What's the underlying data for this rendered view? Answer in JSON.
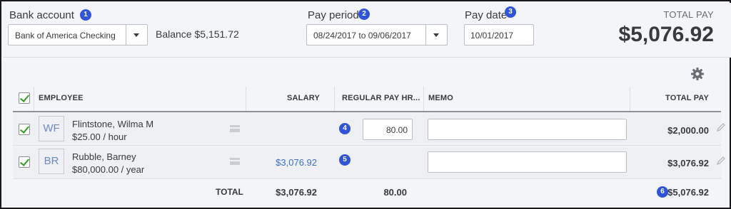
{
  "header": {
    "bank_account_label": "Bank account",
    "bank_account_value": "Bank of America Checking",
    "balance": "Balance $5,151.72",
    "pay_period_label": "Pay period",
    "pay_period_value": "08/24/2017 to 09/06/2017",
    "pay_date_label": "Pay date",
    "pay_date_value": "10/01/2017",
    "total_pay_label": "TOTAL PAY",
    "total_pay_value": "$5,076.92"
  },
  "badges": [
    "1",
    "2",
    "3",
    "4",
    "5",
    "6"
  ],
  "table": {
    "columns": [
      "EMPLOYEE",
      "SALARY",
      "REGULAR PAY HR...",
      "MEMO",
      "TOTAL PAY"
    ],
    "rows": [
      {
        "initials": "WF",
        "name": "Flintstone, Wilma M",
        "rate": "$25.00 / hour",
        "salary": "",
        "hours": "80.00",
        "memo": "",
        "total": "$2,000.00"
      },
      {
        "initials": "BR",
        "name": "Rubble, Barney",
        "rate": "$80,000.00 / year",
        "salary": "$3,076.92",
        "hours": "",
        "memo": "",
        "total": "$3,076.92"
      }
    ],
    "totals": {
      "label": "TOTAL",
      "salary": "$3,076.92",
      "hours": "80.00",
      "total": "$5,076.92"
    }
  },
  "colors": {
    "accent_badge": "#2f54d8",
    "check_green": "#2ca01c",
    "salary_link": "#3b6fc9"
  },
  "icons": [
    "gear-icon",
    "dropdown-arrow-icon",
    "card-icon",
    "pencil-icon",
    "checkbox-icon"
  ]
}
